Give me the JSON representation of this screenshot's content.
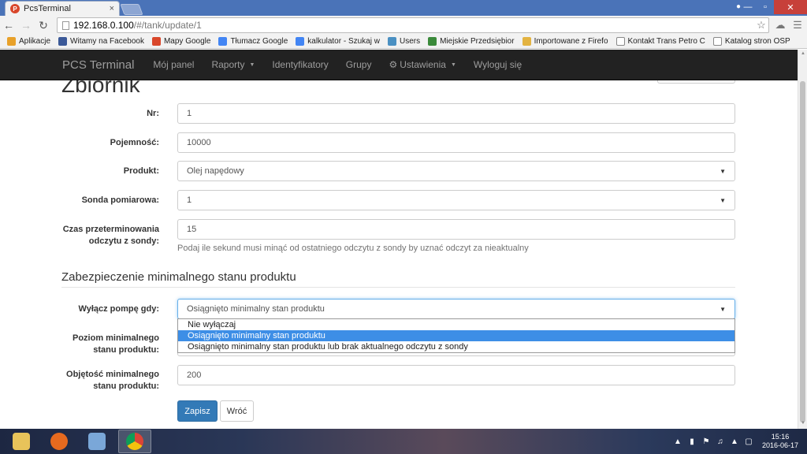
{
  "browser": {
    "tab_title": "PcsTerminal",
    "tab_close": "×",
    "url_host": "192.168.0.100",
    "url_path": "/#/tank/update/1",
    "window_controls": [
      "—",
      "▫",
      "✕"
    ],
    "bookmarks": [
      {
        "label": "Aplikacje",
        "icon": "apps-grid-icon",
        "color": "#e8a12a"
      },
      {
        "label": "Witamy na Facebook",
        "icon": "facebook-icon",
        "color": "#3b5998"
      },
      {
        "label": "Mapy Google",
        "icon": "maps-pin-icon",
        "color": "#d9472b"
      },
      {
        "label": "Tłumacz Google",
        "icon": "translate-icon",
        "color": "#4285f4"
      },
      {
        "label": "kalkulator - Szukaj w",
        "icon": "google-g-icon",
        "color": "#4285f4"
      },
      {
        "label": "Users",
        "icon": "globe-icon",
        "color": "#4a90c2"
      },
      {
        "label": "Miejskie Przedsiębior",
        "icon": "site-icon",
        "color": "#3a8a3a"
      },
      {
        "label": "Importowane z Firefo",
        "icon": "folder-icon",
        "color": "#e3b341"
      },
      {
        "label": "Kontakt Trans Petro C",
        "icon": "page-icon",
        "color": "#ffffff"
      },
      {
        "label": "Katalog stron OSP",
        "icon": "page-icon",
        "color": "#ffffff"
      }
    ]
  },
  "navbar": {
    "brand": "PCS Terminal",
    "items": [
      {
        "label": "Mój panel",
        "caret": false
      },
      {
        "label": "Raporty",
        "caret": true
      },
      {
        "label": "Identyfikatory",
        "caret": false
      },
      {
        "label": "Grupy",
        "caret": false
      },
      {
        "label": "Ustawienia",
        "caret": true,
        "icon": "gear-icon"
      },
      {
        "label": "Wyloguj się",
        "caret": false
      }
    ]
  },
  "page": {
    "heading": "Zbiornik",
    "fields": {
      "nr": {
        "label": "Nr:",
        "value": "1"
      },
      "capacity": {
        "label": "Pojemność:",
        "value": "10000"
      },
      "product": {
        "label": "Produkt:",
        "value": "Olej napędowy"
      },
      "probe": {
        "label": "Sonda pomiarowa:",
        "value": "1"
      },
      "expiry": {
        "label_line1": "Czas przeterminowania",
        "label_line2": "odczytu z sondy:",
        "value": "15",
        "help": "Podaj ile sekund musi minąć od ostatniego odczytu z sondy by uznać odczyt za nieaktualny"
      }
    },
    "section_title": "Zabezpieczenie minimalnego stanu produktu",
    "pump_off": {
      "label": "Wyłącz pompę gdy:",
      "value": "Osiągnięto minimalny stan produktu",
      "options": [
        "Nie wyłączaj",
        "Osiągnięto minimalny stan produktu",
        "Osiągnięto minimalny stan produktu lub brak aktualnego odczytu z sondy"
      ],
      "selected_index": 1
    },
    "min_level": {
      "label_line1": "Poziom minimalnego",
      "label_line2": "stanu produktu:"
    },
    "min_volume": {
      "label_line1": "Objętość minimalnego",
      "label_line2": "stanu produktu:",
      "value": "200"
    },
    "save_label": "Zapisz",
    "back_label": "Wróć"
  },
  "taskbar": {
    "apps": [
      {
        "name": "file-explorer-icon",
        "color": "#e8c35a"
      },
      {
        "name": "firefox-icon",
        "color": "#e66a1f"
      },
      {
        "name": "paint-icon",
        "color": "#7aa7d8"
      },
      {
        "name": "chrome-icon",
        "color": "#3cba54"
      }
    ],
    "time": "15:16",
    "date": "2016-06-17"
  }
}
